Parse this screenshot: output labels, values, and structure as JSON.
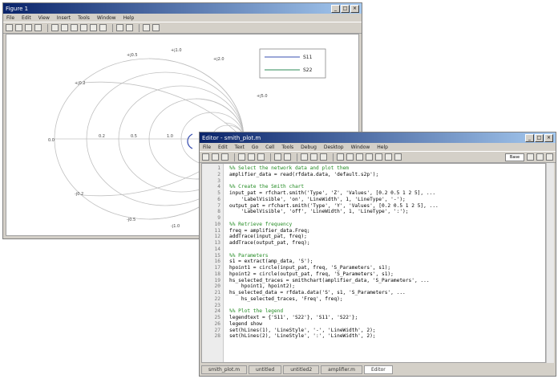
{
  "figure_window": {
    "title": "Figure 1",
    "menus": [
      "File",
      "Edit",
      "View",
      "Insert",
      "Tools",
      "Window",
      "Help"
    ],
    "smith_chart": {
      "outer_labels": [
        "+j0.5",
        "+j1.0",
        "+j2.0",
        "+j0.2",
        "+j5.0",
        "0.0",
        "-j0.2",
        "-j0.5",
        "-j1.0",
        "-j2.0",
        "-j5.0"
      ],
      "inner_labels": [
        "0.2",
        "0.5",
        "1.0"
      ]
    },
    "legend": [
      "S11",
      "S22"
    ],
    "colors": {
      "trace_1": "#3a4fb0",
      "trace_2": "#2e8b57",
      "grid": "#c0c0c0"
    }
  },
  "editor_window": {
    "title": "Editor - smith_plot.m",
    "menus": [
      "File",
      "Edit",
      "Text",
      "Go",
      "Cell",
      "Tools",
      "Debug",
      "Desktop",
      "Window",
      "Help"
    ],
    "stack_label": "Base",
    "lines": [
      {
        "n": "1",
        "t": "%% Select the network data and plot them",
        "type": "c"
      },
      {
        "n": "2",
        "t": "amplifier_data = read(rfdata.data, 'default.s2p');",
        "type": "code"
      },
      {
        "n": "3",
        "t": "",
        "type": "code"
      },
      {
        "n": "4",
        "t": "%% Create the Smith chart",
        "type": "c"
      },
      {
        "n": "5",
        "t": "input_pat = rfchart.smith('Type', 'Z', 'Values', [0.2 0.5 1 2 5], ...",
        "type": "code"
      },
      {
        "n": "6",
        "t": "    'LabelVisible', 'on', 'LineWidth', 1, 'LineType', '-');",
        "type": "code"
      },
      {
        "n": "7",
        "t": "output_pat = rfchart.smith('Type', 'Y', 'Values', [0.2 0.5 1 2 5], ...",
        "type": "code"
      },
      {
        "n": "8",
        "t": "    'LabelVisible', 'off', 'LineWidth', 1, 'LineType', ':');",
        "type": "code"
      },
      {
        "n": "9",
        "t": "",
        "type": "code"
      },
      {
        "n": "10",
        "t": "%% Retrieve frequency",
        "type": "c"
      },
      {
        "n": "11",
        "t": "freq = amplifier_data.Freq;",
        "type": "code"
      },
      {
        "n": "12",
        "t": "addTrace(input_pat, freq);",
        "type": "code"
      },
      {
        "n": "13",
        "t": "addTrace(output_pat, freq);",
        "type": "code"
      },
      {
        "n": "14",
        "t": "",
        "type": "code"
      },
      {
        "n": "15",
        "t": "%% Parameters",
        "type": "c"
      },
      {
        "n": "16",
        "t": "s1 = extract(amp_data, 'S');",
        "type": "code"
      },
      {
        "n": "17",
        "t": "hpoint1 = circle(input_pat, freq, 'S_Parameters', s1);",
        "type": "code"
      },
      {
        "n": "18",
        "t": "hpoint2 = circle(output_pat, freq, 'S_Parameters', s1);",
        "type": "code"
      },
      {
        "n": "19",
        "t": "hs_selected_traces = smithchart(amplifier_data, 'S_Parameters', ...",
        "type": "code"
      },
      {
        "n": "20",
        "t": "    hpoint1, hpoint2);",
        "type": "code"
      },
      {
        "n": "21",
        "t": "hs_selected_data = rfdata.data('S', s1, 'S_Parameters', ...",
        "type": "code"
      },
      {
        "n": "22",
        "t": "    hs_selected_traces, 'Freq', freq);",
        "type": "code"
      },
      {
        "n": "23",
        "t": "",
        "type": "code"
      },
      {
        "n": "24",
        "t": "%% Plot the legend",
        "type": "c"
      },
      {
        "n": "25",
        "t": "legendtext = {'S11', 'S22'}, 'S11', 'S22'};",
        "type": "code"
      },
      {
        "n": "26",
        "t": "legend show",
        "type": "code"
      },
      {
        "n": "27",
        "t": "set(hLines(1), 'LineStyle', '-', 'LineWidth', 2);",
        "type": "code"
      },
      {
        "n": "28",
        "t": "set(hLines(2), 'LineStyle', ':', 'LineWidth', 2);",
        "type": "code"
      }
    ],
    "tabs": [
      "smith_plot.m",
      "untitled",
      "untitled2",
      "amplifier.m",
      "Editor"
    ]
  }
}
